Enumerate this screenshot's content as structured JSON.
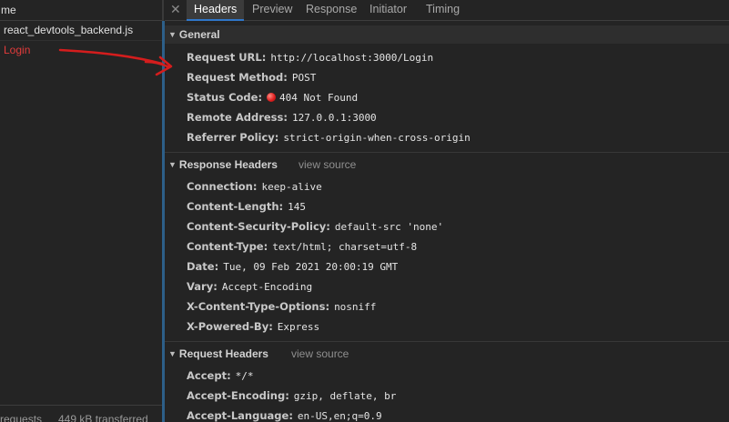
{
  "left": {
    "column_header": "me",
    "requests": [
      {
        "name": "react_devtools_backend.js",
        "status": "selected"
      },
      {
        "name": "Login",
        "status": "error"
      }
    ],
    "footer": {
      "requests": "requests",
      "transferred": "449 kB transferred"
    }
  },
  "tabs": [
    "Headers",
    "Preview",
    "Response",
    "Initiator",
    "Timing"
  ],
  "general": {
    "title": "General",
    "rows": [
      {
        "key": "Request URL:",
        "value": "http://localhost:3000/Login"
      },
      {
        "key": "Request Method:",
        "value": "POST"
      },
      {
        "key": "Status Code:",
        "value": "404 Not Found"
      },
      {
        "key": "Remote Address:",
        "value": "127.0.0.1:3000"
      },
      {
        "key": "Referrer Policy:",
        "value": "strict-origin-when-cross-origin"
      }
    ]
  },
  "response_headers": {
    "title": "Response Headers",
    "view_source": "view source",
    "rows": [
      {
        "key": "Connection:",
        "value": "keep-alive"
      },
      {
        "key": "Content-Length:",
        "value": "145"
      },
      {
        "key": "Content-Security-Policy:",
        "value": "default-src 'none'"
      },
      {
        "key": "Content-Type:",
        "value": "text/html; charset=utf-8"
      },
      {
        "key": "Date:",
        "value": "Tue, 09 Feb 2021 20:00:19 GMT"
      },
      {
        "key": "Vary:",
        "value": "Accept-Encoding"
      },
      {
        "key": "X-Content-Type-Options:",
        "value": "nosniff"
      },
      {
        "key": "X-Powered-By:",
        "value": "Express"
      }
    ]
  },
  "request_headers": {
    "title": "Request Headers",
    "view_source": "view source",
    "rows": [
      {
        "key": "Accept:",
        "value": "*/*"
      },
      {
        "key": "Accept-Encoding:",
        "value": "gzip, deflate, br"
      },
      {
        "key": "Accept-Language:",
        "value": "en-US,en;q=0.9"
      }
    ]
  },
  "icons": {
    "close": "close-icon",
    "status": "red-status-dot-icon",
    "collapse": "triangle-down-icon"
  },
  "colors": {
    "error": "#e23b3b",
    "active_tab_underline": "#2f76c9",
    "annotation": "#d41d1d"
  }
}
